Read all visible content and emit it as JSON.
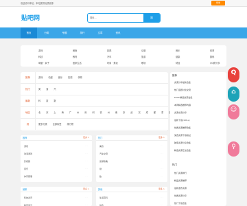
{
  "topbar": {
    "left_text": "欢迎访问本站，本站提供优质资源",
    "right_button": "登录"
  },
  "header": {
    "logo": "贴吧网",
    "search_placeholder": "搜索…",
    "search_button": "搜"
  },
  "nav": {
    "items": [
      "首页",
      "分类",
      "专题",
      "排行",
      "文章",
      "资讯"
    ]
  },
  "categories": [
    [
      "游戏",
      "美食",
      "影视",
      "动漫",
      "音乐",
      "体育"
    ],
    [
      "科技",
      "教育",
      "汽车",
      "旅游",
      "健康",
      "数码"
    ],
    [
      "母婴 · 亲子",
      "居家生活",
      "时尚 · 美妆",
      "职场",
      "财经",
      "QQ群分享"
    ]
  ],
  "rows": [
    {
      "label": "推荐",
      "tags": [
        "游戏",
        "动漫",
        "音乐",
        "影视",
        "体育"
      ]
    },
    {
      "label": "热门",
      "tags": [
        "美",
        "食",
        "汽"
      ]
    },
    {
      "label": "最新",
      "tags": [
        "科",
        "技",
        "数"
      ]
    },
    {
      "label": "地区",
      "tags": [
        "北",
        "京",
        "上",
        "海",
        "广",
        "州",
        "深",
        "圳",
        "杭",
        "州",
        "南",
        "京",
        "武",
        "汉",
        "成",
        "都",
        "重",
        "庆",
        "西",
        "安",
        "天",
        "津",
        "长"
      ]
    },
    {
      "label": "其",
      "tags": [
        "更多分类",
        "全部标签",
        "排行榜"
      ]
    }
  ],
  "right_panel": {
    "title_1": "推荐",
    "links_1": [
      "资源分享最新合集",
      "热门话题讨论交流",
      "Kotlin精选资源合集",
      "本周精选推荐内容",
      "资源交流分享",
      "最新下载(100+)",
      "优质资源推荐合集",
      "免费资源下载地址",
      "独家资源分享合集",
      "精选资源汇总合集"
    ],
    "title_2": "热门",
    "links_2": [
      "热门资源排行",
      "精品资源推荐",
      "最新发布资源",
      "优质资源分享",
      "热门下载合集"
    ]
  },
  "float_buttons": [
    {
      "glyph": "Q",
      "cap": "",
      "color": "#e8413c"
    },
    {
      "glyph": "⌂",
      "cap": "",
      "color": "#1ca3b8"
    },
    {
      "glyph": "☺",
      "cap": "",
      "color": "#f07a9a"
    },
    {
      "glyph": "♀",
      "cap": "",
      "color": "#f07a9a"
    }
  ],
  "cards": [
    {
      "title": "推荐",
      "more": "更多 >",
      "items": [
        "游戏",
        "动漫游戏",
        "影视剧",
        "音乐",
        "体育赛事"
      ]
    },
    {
      "title": "热门",
      "more": "更多 >",
      "items": [
        "美食",
        "汽车交流",
        "旅游攻略",
        "健",
        "数"
      ]
    },
    {
      "title": "最新",
      "more": "更多 >",
      "items": [
        "科技资讯",
        "教育学习"
      ]
    },
    {
      "title": "其他",
      "more": "更多 >",
      "items": [
        "生活百科",
        "综合"
      ]
    }
  ],
  "colors": {
    "accent": "#1e9fe8",
    "nav": "#3aa6e8",
    "orange": "#ff8a00",
    "label": "#e25c2a"
  }
}
